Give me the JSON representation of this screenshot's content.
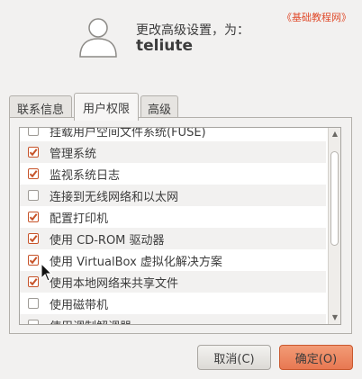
{
  "header": {
    "line1": "更改高级设置，为：",
    "username": "teliute",
    "watermark": "《基础教程网》"
  },
  "tabs": [
    {
      "label": "联系信息",
      "active": false
    },
    {
      "label": "用户权限",
      "active": true
    },
    {
      "label": "高级",
      "active": false
    }
  ],
  "privileges": [
    {
      "label": "挂载用户空间文件系统(FUSE)",
      "checked": false
    },
    {
      "label": "管理系统",
      "checked": true
    },
    {
      "label": "监视系统日志",
      "checked": true
    },
    {
      "label": "连接到无线网络和以太网",
      "checked": false
    },
    {
      "label": "配置打印机",
      "checked": true
    },
    {
      "label": "使用 CD-ROM 驱动器",
      "checked": true
    },
    {
      "label": "使用 VirtualBox 虚拟化解决方案",
      "checked": true
    },
    {
      "label": "使用本地网络来共享文件",
      "checked": true
    },
    {
      "label": "使用磁带机",
      "checked": false
    },
    {
      "label": "使用调制解调器",
      "checked": false
    }
  ],
  "buttons": {
    "cancel": "取消(C)",
    "ok": "确定(O)"
  },
  "colors": {
    "accent": "#e87852",
    "check": "#c7542a",
    "watermark": "#e04b2b"
  },
  "icons": {
    "avatar": "user-silhouette-icon",
    "scroll_up": "scroll-up-arrow-icon",
    "scroll_down": "scroll-down-arrow-icon",
    "cursor": "mouse-pointer-icon"
  }
}
